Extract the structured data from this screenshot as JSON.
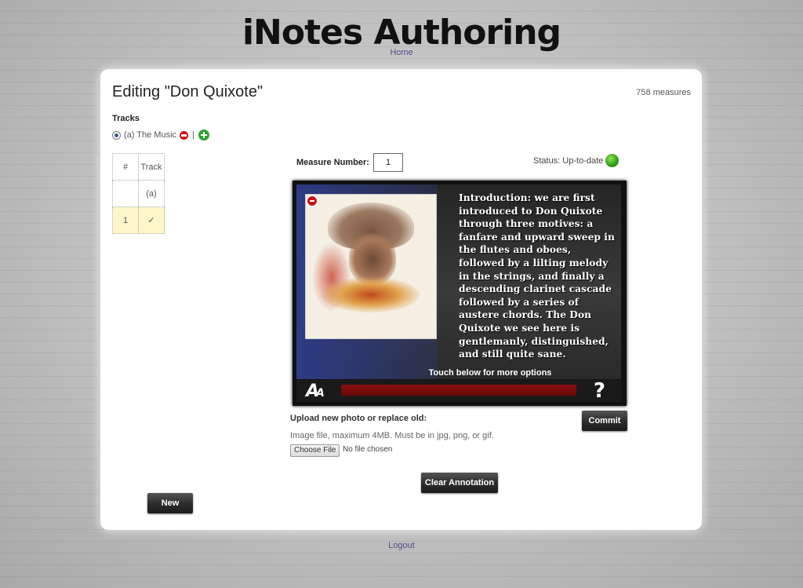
{
  "header": {
    "title": "iNotes Authoring",
    "home_link": "Home"
  },
  "editor": {
    "title": "Editing \"Don Quixote\"",
    "measure_count": "758 measures"
  },
  "tracks": {
    "label": "Tracks",
    "selected_track": "(a) The Music",
    "separator": "|",
    "table": {
      "headers": [
        "#",
        "Track"
      ],
      "rows": [
        {
          "num": "",
          "track": "(a)"
        },
        {
          "num": "1",
          "track": "✓"
        }
      ]
    }
  },
  "measure": {
    "label": "Measure Number:",
    "value": "1"
  },
  "status": {
    "text": "Status: Up-to-date",
    "color": "#2f9a12"
  },
  "viewer": {
    "annotation": "Introduction: we are first introduced to Don Quixote through three motives: a fanfare and upward sweep in the flutes and oboes, followed by a lilting melody in the strings, and finally a descending clarinet cascade followed by a series of austere chords.  The Don Quixote we see here is gentlemanly, distinguished, and still quite sane.",
    "touch_hint": "Touch below for more options",
    "font_icon_big": "A",
    "font_icon_small": "A",
    "help_icon": "?",
    "progress": 1.0
  },
  "upload": {
    "label": "Upload new photo or replace old:",
    "hint": "Image file, maximum 4MB. Must be in jpg, png, or gif.",
    "file_button": "Choose File",
    "file_status": "No file chosen"
  },
  "buttons": {
    "commit": "Commit",
    "clear": "Clear Annotation",
    "new": "New"
  },
  "footer": {
    "logout": "Logout"
  },
  "colors": {
    "accent_link": "#5a4a8a",
    "remove": "#c81414",
    "add": "#2ea52e",
    "selected_row": "#fdf6c8"
  }
}
